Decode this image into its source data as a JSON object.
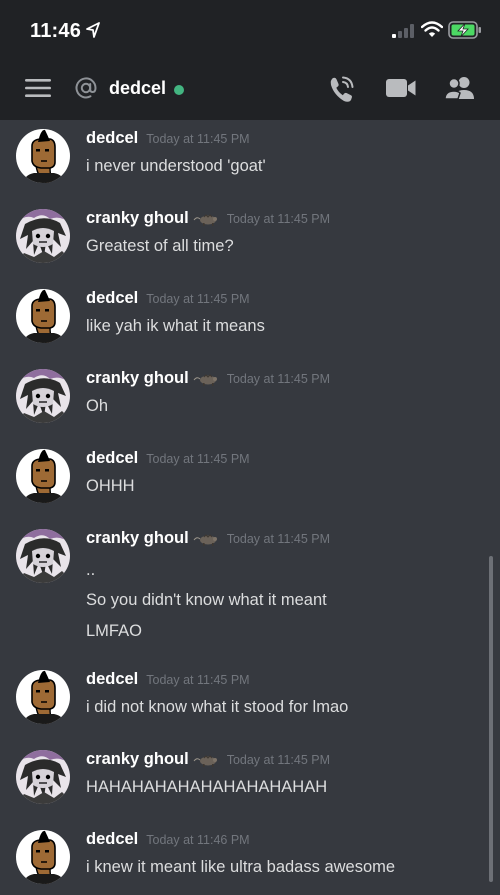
{
  "status_bar": {
    "time": "11:46",
    "icons": [
      "location-arrow-icon",
      "signal-icon",
      "wifi-icon",
      "battery-charging-icon"
    ]
  },
  "header": {
    "channel_name": "dedcel",
    "status": "online",
    "icons": [
      "menu-icon",
      "at-icon",
      "voice-call-icon",
      "video-call-icon",
      "members-icon"
    ]
  },
  "colors": {
    "background": "#36393f",
    "header_bg": "#202225",
    "online": "#43b581",
    "timestamp": "#72767d",
    "text": "#dcddde"
  },
  "messages": [
    {
      "author": "dedcel",
      "timestamp": "Today at 11:45 PM",
      "lines": [
        "i never understood 'goat'"
      ]
    },
    {
      "author": "cranky ghoul",
      "timestamp": "Today at 11:45 PM",
      "lines": [
        "Greatest of all time?"
      ]
    },
    {
      "author": "dedcel",
      "timestamp": "Today at 11:45 PM",
      "lines": [
        "like yah ik what it means"
      ]
    },
    {
      "author": "cranky ghoul",
      "timestamp": "Today at 11:45 PM",
      "lines": [
        "Oh"
      ]
    },
    {
      "author": "dedcel",
      "timestamp": "Today at 11:45 PM",
      "lines": [
        "OHHH"
      ]
    },
    {
      "author": "cranky ghoul",
      "timestamp": "Today at 11:45 PM",
      "lines": [
        "..",
        "So you didn't know what it meant",
        "LMFAO"
      ]
    },
    {
      "author": "dedcel",
      "timestamp": "Today at 11:45 PM",
      "lines": [
        "i did not know what it stood for lmao"
      ]
    },
    {
      "author": "cranky ghoul",
      "timestamp": "Today at 11:45 PM",
      "lines": [
        "HAHAHAHAHAHAHAHAHAHAH"
      ]
    },
    {
      "author": "dedcel",
      "timestamp": "Today at 11:46 PM",
      "lines": [
        "i knew it meant like ultra badass awesome"
      ]
    }
  ]
}
